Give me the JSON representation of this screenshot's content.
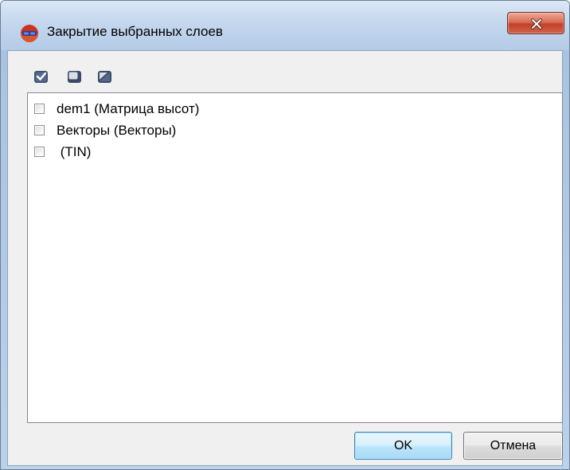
{
  "window": {
    "title": "Закрытие выбранных слоев",
    "icon": "app-logo-icon",
    "close_icon": "close-icon"
  },
  "toolbar": {
    "buttons": [
      {
        "icon": "check-all-icon"
      },
      {
        "icon": "uncheck-all-icon"
      },
      {
        "icon": "invert-selection-icon"
      }
    ]
  },
  "layers": {
    "items": [
      {
        "label": "dem1 (Матрица высот)",
        "checked": false
      },
      {
        "label": "Векторы (Векторы)",
        "checked": false
      },
      {
        "label": " (TIN)",
        "checked": false
      }
    ]
  },
  "buttons": {
    "ok_label": "OK",
    "cancel_label": "Отмена"
  },
  "colors": {
    "accent": "#3c7fb1",
    "close_button": "#c1412a",
    "frame": "#b3cbe6"
  }
}
